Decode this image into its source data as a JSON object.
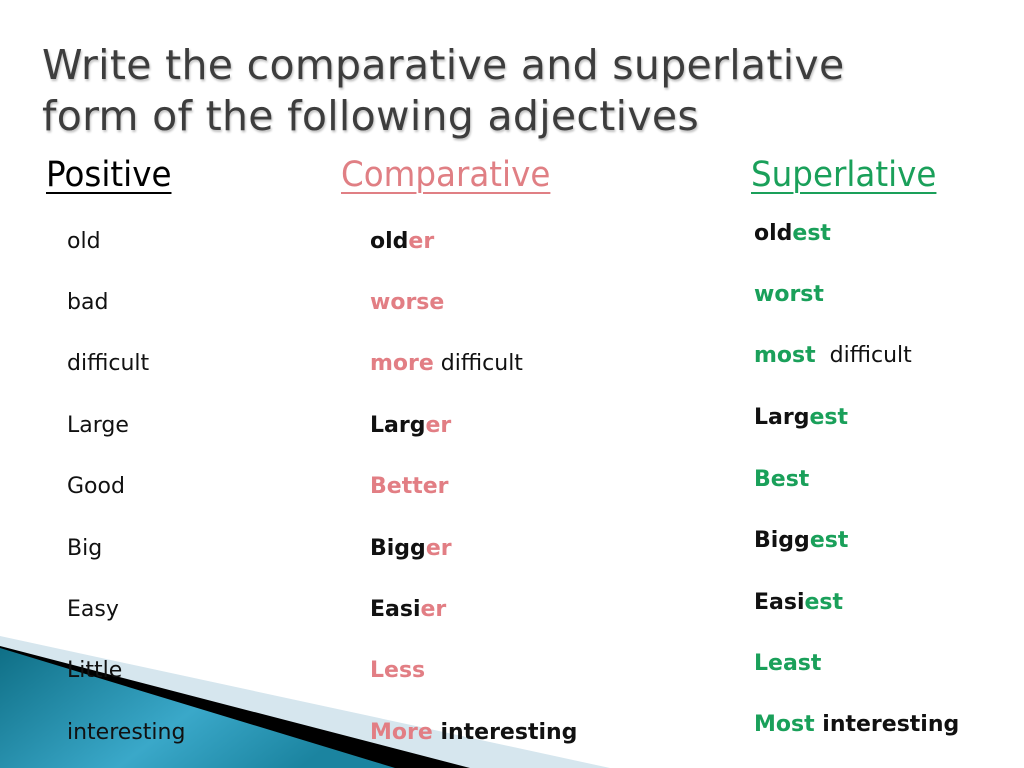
{
  "title_line1": "Write the comparative and superlative",
  "title_line2": "form of the following adjectives",
  "headers": {
    "positive": "Positive",
    "comparative": "Comparative",
    "superlative": "Superlative"
  },
  "colors": {
    "title": "#3d3d3d",
    "comparative": "#e27e84",
    "superlative": "#1aa05a",
    "teal": "#1b84a0"
  },
  "rows": [
    {
      "positive": "old",
      "comparative": [
        {
          "t": "old",
          "c": "black"
        },
        {
          "t": "er",
          "c": "pink"
        }
      ],
      "superlative": [
        {
          "t": "old",
          "c": "black"
        },
        {
          "t": "est",
          "c": "green"
        }
      ]
    },
    {
      "positive": "bad",
      "comparative": [
        {
          "t": "worse",
          "c": "pink"
        }
      ],
      "superlative": [
        {
          "t": "worst",
          "c": "green"
        }
      ]
    },
    {
      "positive": "difficult",
      "comparative": [
        {
          "t": "more",
          "c": "pink"
        },
        {
          "t": " difficult",
          "c": "plain"
        }
      ],
      "superlative": [
        {
          "t": "most",
          "c": "green"
        },
        {
          "t": "  difficult",
          "c": "plain"
        }
      ]
    },
    {
      "positive": "Large",
      "comparative": [
        {
          "t": "Larg",
          "c": "black"
        },
        {
          "t": "er",
          "c": "pink"
        }
      ],
      "superlative": [
        {
          "t": "Larg",
          "c": "black"
        },
        {
          "t": "est",
          "c": "green"
        }
      ]
    },
    {
      "positive": "Good",
      "comparative": [
        {
          "t": "Better",
          "c": "pink"
        }
      ],
      "superlative": [
        {
          "t": "Best",
          "c": "green"
        }
      ]
    },
    {
      "positive": "Big",
      "comparative": [
        {
          "t": "Bigg",
          "c": "black"
        },
        {
          "t": "er",
          "c": "pink"
        }
      ],
      "superlative": [
        {
          "t": "Bigg",
          "c": "black"
        },
        {
          "t": "est",
          "c": "green"
        }
      ]
    },
    {
      "positive": "Easy",
      "comparative": [
        {
          "t": "Easi",
          "c": "black"
        },
        {
          "t": "er",
          "c": "pink"
        }
      ],
      "superlative": [
        {
          "t": "Easi",
          "c": "black"
        },
        {
          "t": "est",
          "c": "green"
        }
      ]
    },
    {
      "positive": "Little",
      "comparative": [
        {
          "t": "Less",
          "c": "pink"
        }
      ],
      "superlative": [
        {
          "t": "Least",
          "c": "green"
        }
      ]
    },
    {
      "positive": "interesting",
      "comparative": [
        {
          "t": "More",
          "c": "pink"
        },
        {
          "t": " interesting",
          "c": "black"
        }
      ],
      "superlative": [
        {
          "t": "Most",
          "c": "green"
        },
        {
          "t": " interesting",
          "c": "black"
        }
      ]
    }
  ]
}
